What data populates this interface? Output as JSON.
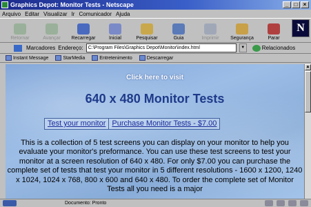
{
  "window": {
    "title": "Graphics Depot: Monitor Tests - Netscape"
  },
  "menu": [
    "Arquivo",
    "Editar",
    "Visualizar",
    "Ir",
    "Comunicador",
    "Ajuda"
  ],
  "toolbar": {
    "buttons": [
      {
        "label": "Retornar",
        "icon": "back-icon",
        "disabled": true
      },
      {
        "label": "Avançar",
        "icon": "forward-icon",
        "disabled": true
      },
      {
        "label": "Recarregar",
        "icon": "reload-icon",
        "disabled": false
      },
      {
        "label": "Inicial",
        "icon": "home-icon",
        "disabled": false
      },
      {
        "label": "Pesquisar",
        "icon": "search-icon",
        "disabled": false
      },
      {
        "label": "Guia",
        "icon": "guide-icon",
        "disabled": false
      },
      {
        "label": "Imprimir",
        "icon": "print-icon",
        "disabled": true
      },
      {
        "label": "Segurança",
        "icon": "lock-icon",
        "disabled": false
      },
      {
        "label": "Parar",
        "icon": "stop-icon",
        "disabled": false
      }
    ],
    "logo": "N"
  },
  "location": {
    "bookmarks_label": "Marcadores",
    "address_label": "Endereço:",
    "url": "C:\\Program Files\\Graphics Depot\\Monitor\\index.html",
    "related_label": "Relacionados"
  },
  "personal_toolbar": [
    "Instant Message",
    "StarMedia",
    "Entretenimento",
    "Descarregar"
  ],
  "page": {
    "click_text": "Click here to visit",
    "title": "640 x 480 Monitor Tests",
    "links": [
      "Test your monitor",
      "Purchase Monitor Tests - $7.00"
    ],
    "description": "This is a collection of 5 test screens you can display on your monitor to help you evaluate your monitor's preformance. You can use these test screens to test your monitor at a screen resolution of 640 x 480. For only $7.00 you can purchase the complete set of tests that test your monitor in 5 different resolutions - 1600 x 1200, 1240 x 1024, 1024 x 768, 800 x 600 and 640 x 480. To order the complete set of Monitor Tests all you need is a major"
  },
  "status": {
    "text": "Documento: Pronto"
  }
}
